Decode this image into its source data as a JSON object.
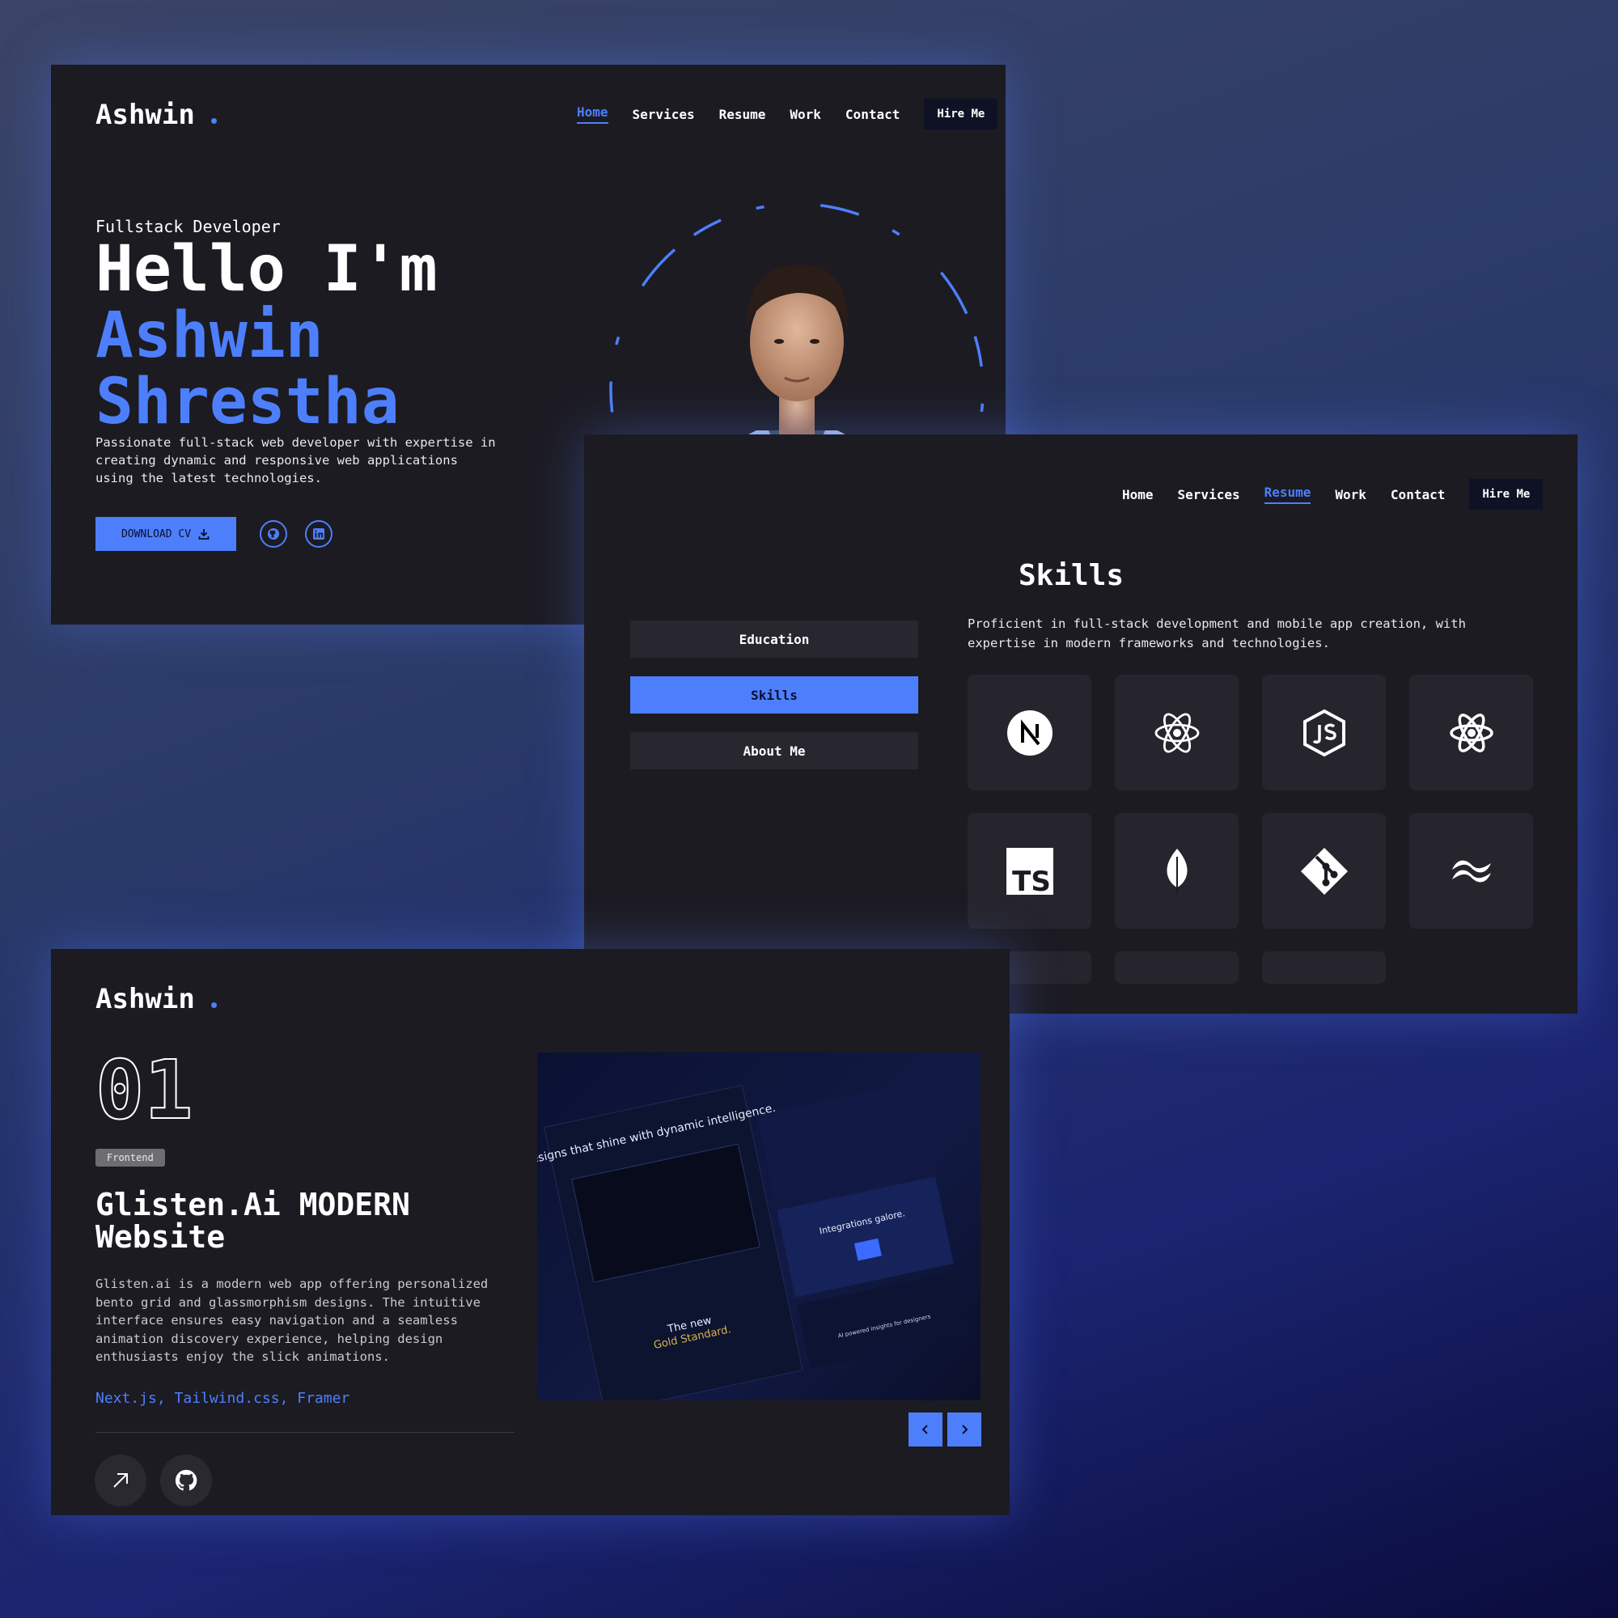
{
  "hero": {
    "logo": "Ashwin",
    "nav": [
      "Home",
      "Services",
      "Resume",
      "Work",
      "Contact"
    ],
    "hire": "Hire Me",
    "role": "Fullstack Developer",
    "hello": "Hello I'm",
    "first_name": "Ashwin",
    "last_name": "Shrestha",
    "description": "Passionate full-stack web developer with expertise in creating dynamic and responsive web applications using the latest technologies.",
    "cv_label": "DOWNLOAD CV",
    "icons": {
      "download": "download-icon",
      "github": "github-icon",
      "linkedin": "linkedin-icon"
    }
  },
  "skills_page": {
    "nav": [
      "Home",
      "Services",
      "Resume",
      "Work",
      "Contact"
    ],
    "hire": "Hire Me",
    "tabs": [
      "Education",
      "Skills",
      "About Me"
    ],
    "active_tab": "Skills",
    "title": "Skills",
    "description": "Proficient in full-stack development and mobile app creation, with expertise in modern frameworks and technologies.",
    "skill_icons": [
      "nextjs-icon",
      "react-icon",
      "nodejs-icon",
      "react-native-icon",
      "typescript-icon",
      "mongodb-icon",
      "git-icon",
      "tailwind-icon"
    ],
    "ts_text": "TS"
  },
  "work": {
    "logo": "Ashwin",
    "number": "01",
    "category": "Frontend",
    "title": "Glisten.Ai MODERN Website",
    "description": "Glisten.ai is a modern web app offering personalized bento grid and glassmorphism designs. The intuitive interface ensures easy navigation and a seamless animation discovery experience, helping design enthusiasts enjoy the slick animations.",
    "stack": "Next.js, Tailwind.css, Framer",
    "preview": {
      "headline": "Designs that shine with dynamic intelligence.",
      "integrations": "Integrations galore.",
      "gold_line1": "The new",
      "gold_line2": "Gold Standard.",
      "ai_line": "AI powered insights for designers"
    },
    "icons": {
      "live": "arrow-up-right-icon",
      "github": "github-icon",
      "prev": "chevron-left-icon",
      "next": "chevron-right-icon"
    }
  },
  "colors": {
    "accent": "#4d7ffd",
    "card": "#1c1b22",
    "tile": "#26252d"
  }
}
